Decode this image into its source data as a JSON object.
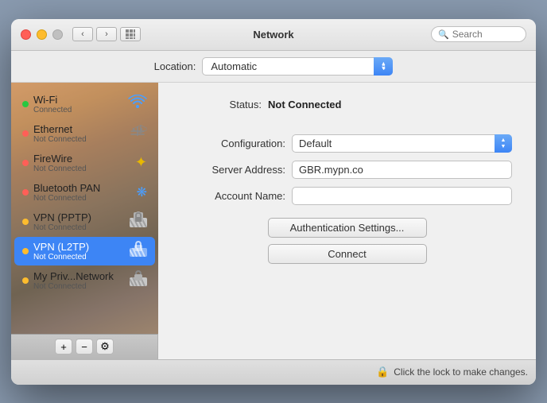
{
  "window": {
    "title": "Network"
  },
  "titlebar": {
    "search_placeholder": "Search"
  },
  "location": {
    "label": "Location:",
    "value": "Automatic"
  },
  "network_list": [
    {
      "id": "wifi",
      "name": "Wi-Fi",
      "status": "Connected",
      "dot": "green",
      "icon": "wifi",
      "selected": false
    },
    {
      "id": "ethernet",
      "name": "Ethernet",
      "status": "Not Connected",
      "dot": "red",
      "icon": "ethernet",
      "selected": false
    },
    {
      "id": "firewire",
      "name": "FireWire",
      "status": "Not Connected",
      "dot": "red",
      "icon": "firewire",
      "selected": false
    },
    {
      "id": "bluetooth",
      "name": "Bluetooth PAN",
      "status": "Not Connected",
      "dot": "red",
      "icon": "bluetooth",
      "selected": false
    },
    {
      "id": "vpn-pptp",
      "name": "VPN (PPTP)",
      "status": "Not Connected",
      "dot": "yellow",
      "icon": "lock",
      "selected": false
    },
    {
      "id": "vpn-l2tp",
      "name": "VPN (L2TP)",
      "status": "Not Connected",
      "dot": "yellow",
      "icon": "lock",
      "selected": true
    },
    {
      "id": "my-priv",
      "name": "My Priv...Network",
      "status": "Not Connected",
      "dot": "yellow",
      "icon": "lock",
      "selected": false
    }
  ],
  "right_panel": {
    "status_label": "Status:",
    "status_value": "Not Connected",
    "configuration_label": "Configuration:",
    "configuration_value": "Default",
    "server_address_label": "Server Address:",
    "server_address_value": "GBR.mypn.co",
    "account_name_label": "Account Name:",
    "account_name_value": "",
    "auth_button_label": "Authentication Settings...",
    "connect_button_label": "Connect"
  },
  "toolbar": {
    "add_label": "+",
    "remove_label": "−",
    "gear_label": "⚙",
    "lock_label": "🔒",
    "lock_text": "Click the lock to make changes."
  }
}
